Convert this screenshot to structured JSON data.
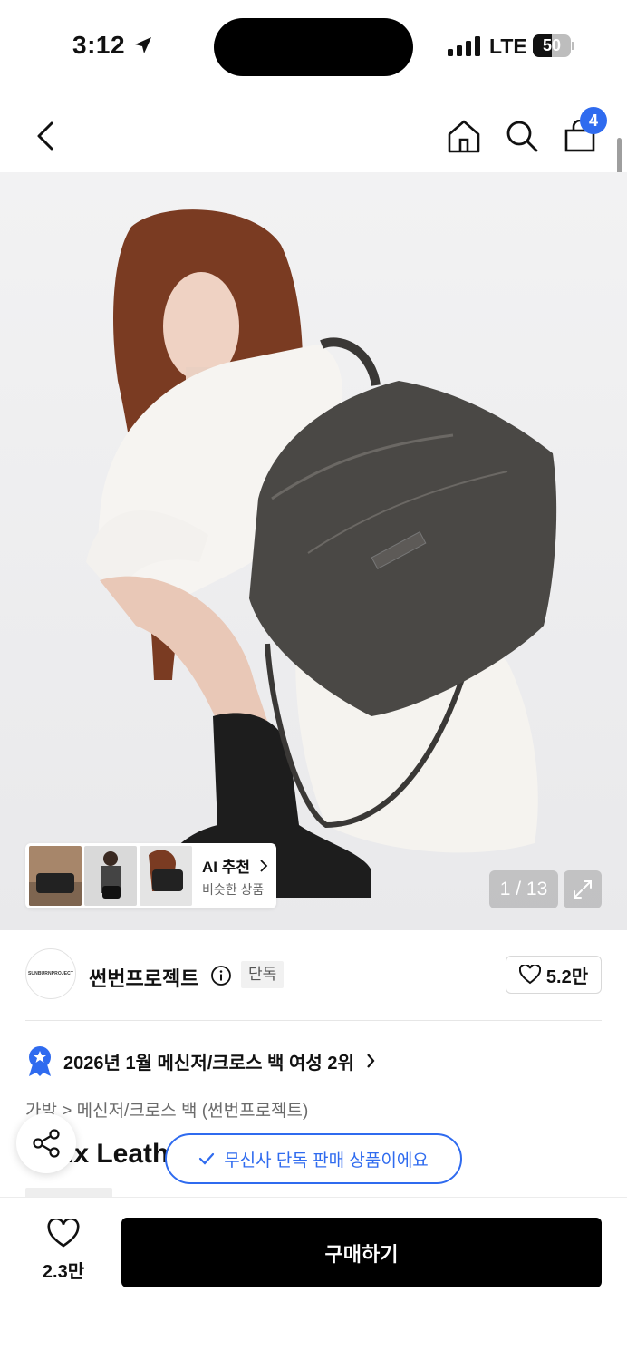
{
  "status_bar": {
    "time": "3:12",
    "carrier": "LTE",
    "battery": "50",
    "battery_level": 0.5
  },
  "nav": {
    "cart_count": "4"
  },
  "gallery": {
    "ai_title": "AI 추천",
    "ai_subtitle": "비슷한 상품",
    "page_counter": "1 / 13"
  },
  "brand": {
    "logo_text": "SUNBURNPROJECT",
    "name": "썬번프로젝트",
    "tag": "단독",
    "likes": "5.2만"
  },
  "ranking": {
    "text": "2026년 1월 메신저/크로스 백 여성 2위"
  },
  "product": {
    "category": "가방 > 메신저/크로스 백 (썬번프로젝트)",
    "title": "Faux Leath"
  },
  "toast": {
    "text": "무신사 단독 판매 상품이에요"
  },
  "bottom_bar": {
    "wish_count": "2.3만",
    "buy_label": "구매하기"
  },
  "colors": {
    "accent": "#2f6bef",
    "buy_button": "#000000"
  }
}
